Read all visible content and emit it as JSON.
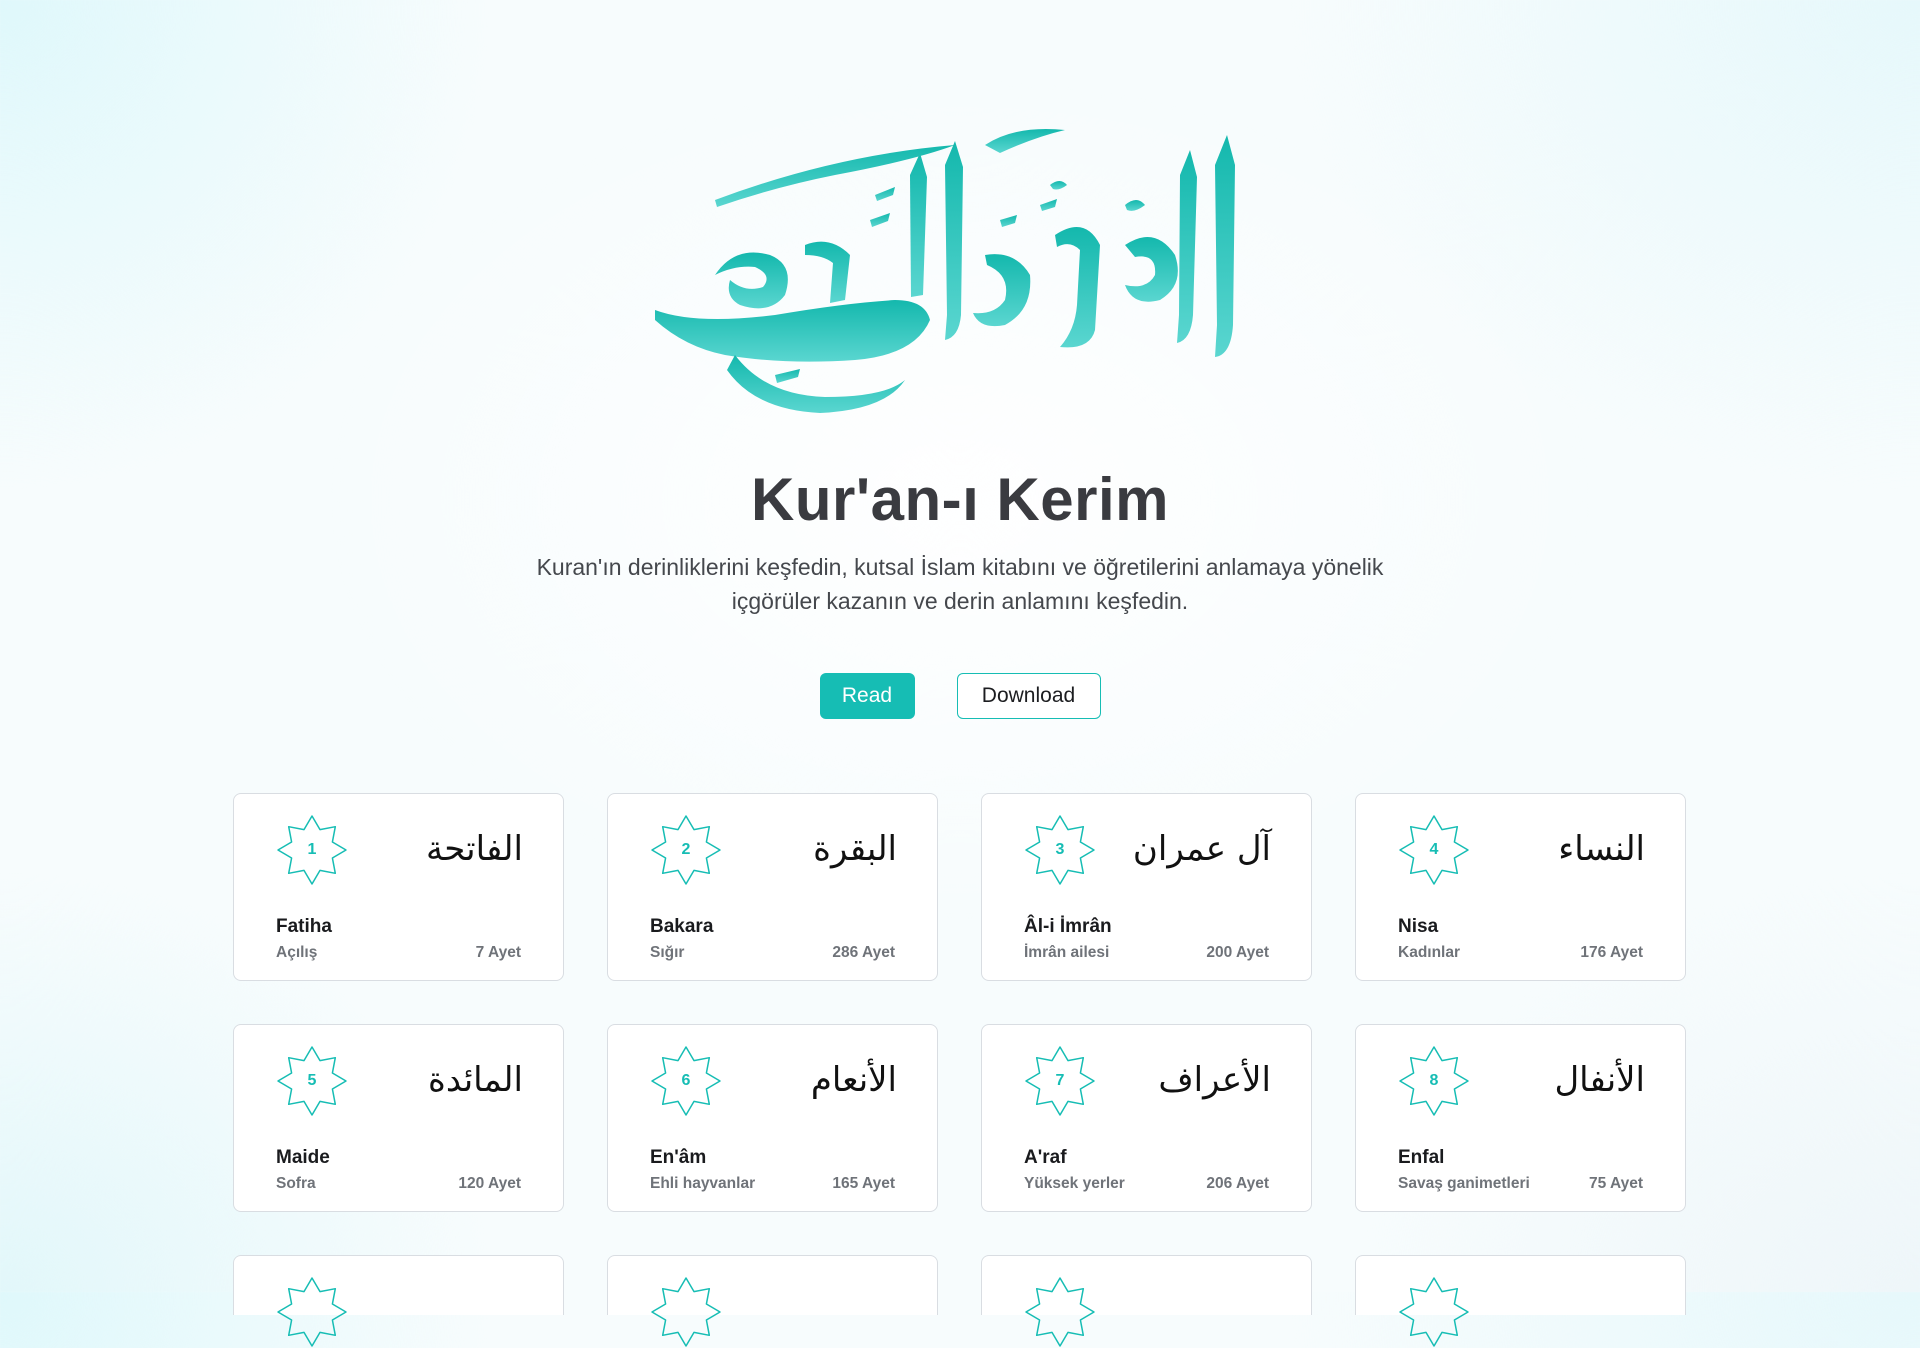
{
  "hero": {
    "logo_text": "القرآن الكريم",
    "title": "Kur'an-ı Kerim",
    "subtitle": "Kuran'ın  derinliklerini keşfedin, kutsal İslam kitabını ve öğretilerini anlamaya  yönelik\niçgörüler kazanın ve derin anlamını keşfedin.",
    "accent_color": "#16bdb4"
  },
  "actions": {
    "read_label": "Read",
    "download_label": "Download"
  },
  "surahs": [
    {
      "number": "1",
      "arabic": "الفاتحة",
      "name": "Fatiha",
      "meaning": "Açılış",
      "ayah": "7 Ayet"
    },
    {
      "number": "2",
      "arabic": "البقرة",
      "name": "Bakara",
      "meaning": "Sığır",
      "ayah": "286 Ayet"
    },
    {
      "number": "3",
      "arabic": "آل عمران",
      "name": "Âl-i İmrân",
      "meaning": "İmrân ailesi",
      "ayah": "200 Ayet"
    },
    {
      "number": "4",
      "arabic": "النساء",
      "name": "Nisa",
      "meaning": "Kadınlar",
      "ayah": "176 Ayet"
    },
    {
      "number": "5",
      "arabic": "المائدة",
      "name": "Maide",
      "meaning": "Sofra",
      "ayah": "120 Ayet"
    },
    {
      "number": "6",
      "arabic": "الأنعام",
      "name": "En'âm",
      "meaning": "Ehli hayvanlar",
      "ayah": "165 Ayet"
    },
    {
      "number": "7",
      "arabic": "الأعراف",
      "name": "A'raf",
      "meaning": "Yüksek yerler",
      "ayah": "206 Ayet"
    },
    {
      "number": "8",
      "arabic": "الأنفال",
      "name": "Enfal",
      "meaning": "Savaş ganimetleri",
      "ayah": "75 Ayet"
    }
  ]
}
